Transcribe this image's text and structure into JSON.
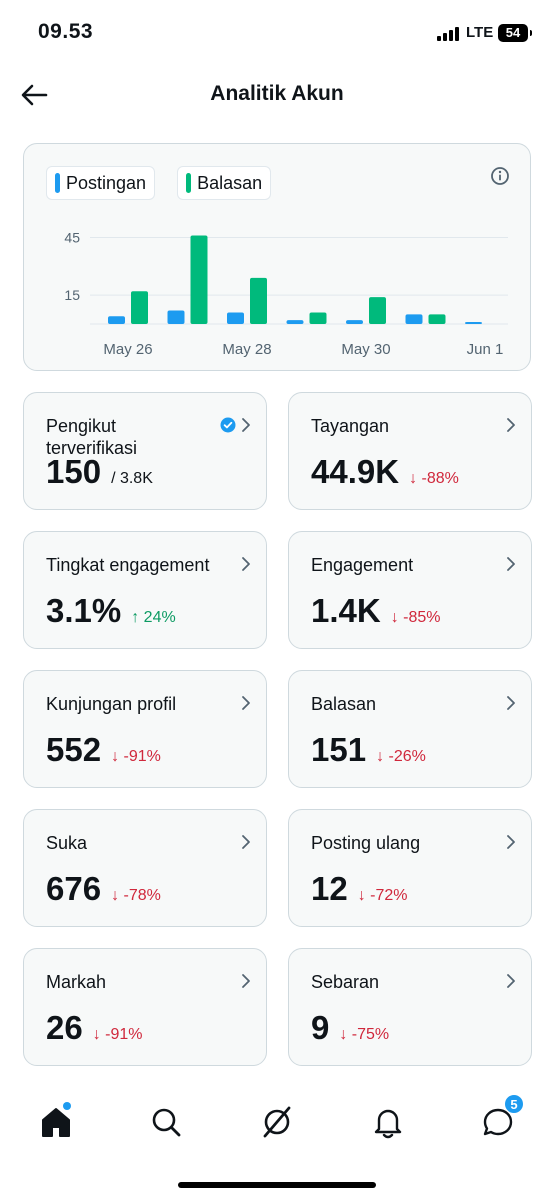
{
  "status_bar": {
    "time": "09.53",
    "network": "LTE",
    "battery": "54"
  },
  "header": {
    "title": "Analitik Akun"
  },
  "chart_data": {
    "type": "bar",
    "categories": [
      "May 26",
      "May 27",
      "May 28",
      "May 29",
      "May 30",
      "May 31",
      "Jun 1"
    ],
    "x_tick_labels": [
      "May 26",
      "May 28",
      "May 30",
      "Jun 1"
    ],
    "y_tick_labels": [
      "45",
      "15"
    ],
    "ylim": [
      0,
      52
    ],
    "series": [
      {
        "name": "Postingan",
        "color": "#1d9bf0",
        "values": [
          4,
          7,
          6,
          2,
          2,
          5,
          1
        ]
      },
      {
        "name": "Balasan",
        "color": "#00ba7c",
        "values": [
          17,
          46,
          24,
          6,
          14,
          5,
          0
        ]
      }
    ],
    "grid": true
  },
  "stats": [
    {
      "label": "Pengikut terverifikasi",
      "value": "150",
      "sub": "/ 3.8K",
      "delta": "",
      "verified": true
    },
    {
      "label": "Tayangan",
      "value": "44.9K",
      "delta": "↓ -88%",
      "direction": "down"
    },
    {
      "label": "Tingkat engagement",
      "value": "3.1%",
      "delta": "↑ 24%",
      "direction": "up"
    },
    {
      "label": "Engagement",
      "value": "1.4K",
      "delta": "↓ -85%",
      "direction": "down"
    },
    {
      "label": "Kunjungan profil",
      "value": "552",
      "delta": "↓ -91%",
      "direction": "down"
    },
    {
      "label": "Balasan",
      "value": "151",
      "delta": "↓ -26%",
      "direction": "down"
    },
    {
      "label": "Suka",
      "value": "676",
      "delta": "↓ -78%",
      "direction": "down"
    },
    {
      "label": "Posting ulang",
      "value": "12",
      "delta": "↓ -72%",
      "direction": "down"
    },
    {
      "label": "Markah",
      "value": "26",
      "delta": "↓ -91%",
      "direction": "down"
    },
    {
      "label": "Sebaran",
      "value": "9",
      "delta": "↓ -75%",
      "direction": "down"
    }
  ],
  "bottom_nav": {
    "items": [
      "home-icon",
      "search-icon",
      "grok-icon",
      "bell-icon",
      "messages-icon"
    ],
    "messages_badge": "5"
  }
}
